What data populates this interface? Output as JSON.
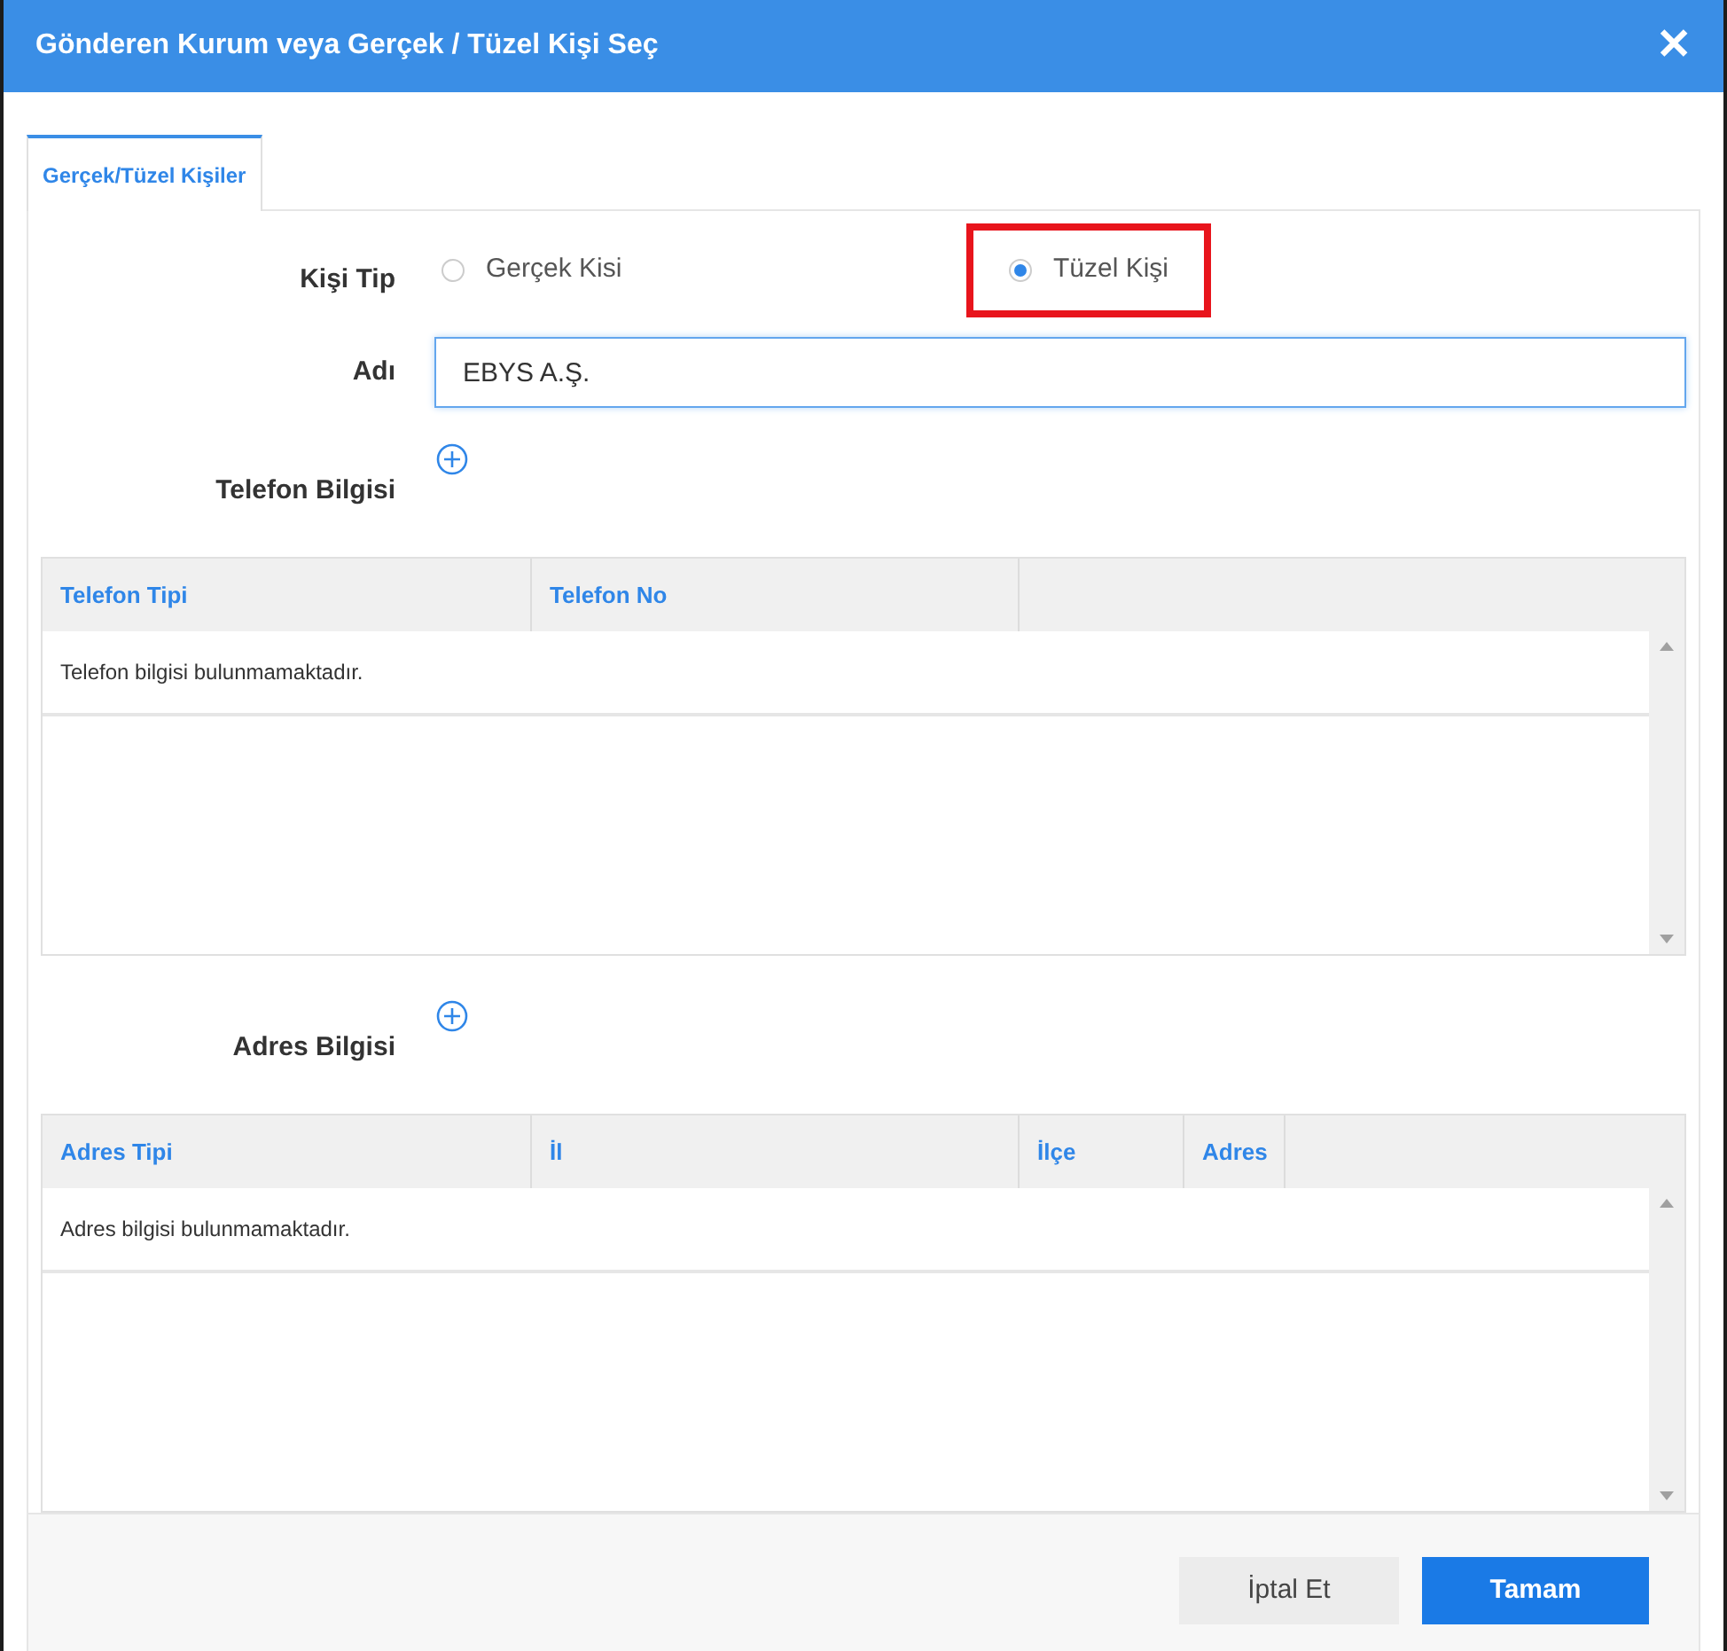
{
  "window": {
    "title": "Gönderen Kurum veya Gerçek / Tüzel Kişi Seç",
    "close": "✕"
  },
  "tabs": [
    {
      "label": "Gerçek/Tüzel Kişiler",
      "selected": true
    }
  ],
  "kisi_tip": {
    "label": "Kişi Tip",
    "options": [
      {
        "label": "Gerçek Kisi",
        "selected": false,
        "highlighted": false
      },
      {
        "label": "Tüzel Kişi",
        "selected": true,
        "highlighted": true
      }
    ]
  },
  "adi": {
    "label": "Adı",
    "value": "EBYS A.Ş."
  },
  "sections": [
    {
      "title": "Telefon Bilgisi",
      "columns": [
        "Telefon Tipi",
        "Telefon No"
      ],
      "empty_message": "Telefon bilgisi bulunmamaktadır."
    },
    {
      "title": "Adres Bilgisi",
      "columns": [
        "Adres Tipi",
        "İl",
        "İlçe",
        "Adres"
      ],
      "empty_message": "Adres bilgisi bulunmamaktadır."
    }
  ],
  "buttons": [
    {
      "label": "İptal Et",
      "kind": "secondary"
    },
    {
      "label": "Tamam",
      "kind": "primary"
    }
  ]
}
